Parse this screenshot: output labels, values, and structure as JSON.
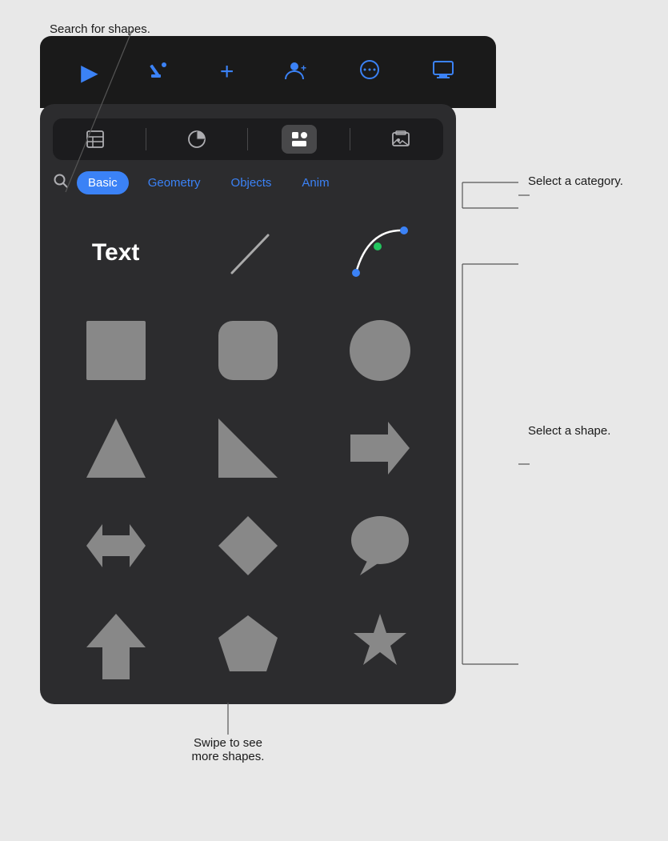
{
  "toolbar": {
    "icons": [
      "play",
      "annotation",
      "plus",
      "add-user",
      "more",
      "monitor"
    ]
  },
  "tabs": [
    {
      "id": "table",
      "label": "⊞",
      "active": false
    },
    {
      "id": "chart",
      "label": "◷",
      "active": false
    },
    {
      "id": "shapes",
      "label": "⬡",
      "active": true
    },
    {
      "id": "media",
      "label": "⊡",
      "active": false
    }
  ],
  "categories": [
    {
      "id": "basic",
      "label": "Basic",
      "active": true
    },
    {
      "id": "geometry",
      "label": "Geometry",
      "active": false
    },
    {
      "id": "objects",
      "label": "Objects",
      "active": false
    },
    {
      "id": "anim",
      "label": "Anim",
      "active": false
    }
  ],
  "annotations": {
    "search": "Search for shapes.",
    "category": "Select a category.",
    "shape": "Select a shape.",
    "swipe": "Swipe to see\nmore shapes."
  },
  "shapes": [
    {
      "id": "text",
      "type": "text",
      "label": "Text"
    },
    {
      "id": "line",
      "type": "line"
    },
    {
      "id": "curve",
      "type": "curve"
    },
    {
      "id": "square",
      "type": "rect",
      "rx": 0
    },
    {
      "id": "rounded-rect",
      "type": "rect",
      "rx": 14
    },
    {
      "id": "circle",
      "type": "circle"
    },
    {
      "id": "triangle",
      "type": "triangle"
    },
    {
      "id": "right-triangle",
      "type": "right-triangle"
    },
    {
      "id": "arrow-right",
      "type": "arrow-right"
    },
    {
      "id": "arrow-horiz",
      "type": "arrow-horiz"
    },
    {
      "id": "diamond",
      "type": "diamond"
    },
    {
      "id": "speech-bubble",
      "type": "speech-bubble"
    },
    {
      "id": "arrow-up",
      "type": "arrow-up"
    },
    {
      "id": "pentagon",
      "type": "pentagon"
    },
    {
      "id": "star",
      "type": "star"
    }
  ]
}
